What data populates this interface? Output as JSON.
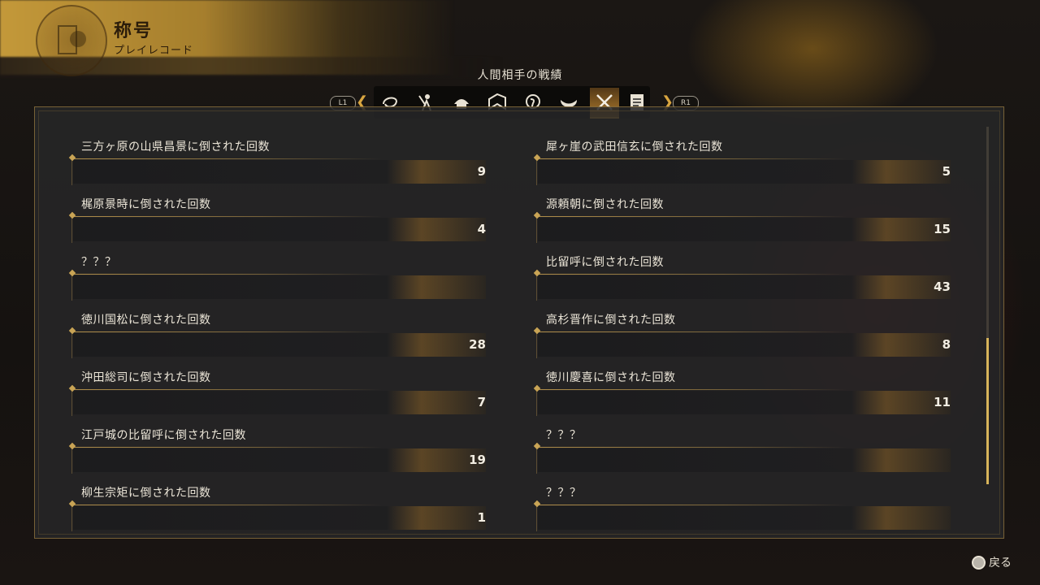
{
  "header": {
    "title": "称号",
    "subtitle": "プレイレコード"
  },
  "category": {
    "title": "人間相手の戦績",
    "left_shoulder": "L1",
    "right_shoulder": "R1",
    "tabs": [
      {
        "icon": "swirl-icon",
        "active": false
      },
      {
        "icon": "warrior-icon",
        "active": false
      },
      {
        "icon": "helmet-icon",
        "active": false
      },
      {
        "icon": "book-icon",
        "active": false
      },
      {
        "icon": "scroll-emblem-icon",
        "active": false
      },
      {
        "icon": "mask-icon",
        "active": false
      },
      {
        "icon": "crossed-swords-icon",
        "active": true
      },
      {
        "icon": "document-icon",
        "active": false
      }
    ]
  },
  "stats_left": [
    {
      "label": "三方ヶ原の山県昌景に倒された回数",
      "value": "9"
    },
    {
      "label": "梶原景時に倒された回数",
      "value": "4"
    },
    {
      "label": "？？？",
      "value": ""
    },
    {
      "label": "徳川国松に倒された回数",
      "value": "28"
    },
    {
      "label": "沖田総司に倒された回数",
      "value": "7"
    },
    {
      "label": "江戸城の比留呼に倒された回数",
      "value": "19"
    },
    {
      "label": "柳生宗矩に倒された回数",
      "value": "1"
    }
  ],
  "stats_right": [
    {
      "label": "犀ヶ崖の武田信玄に倒された回数",
      "value": "5"
    },
    {
      "label": "源頼朝に倒された回数",
      "value": "15"
    },
    {
      "label": "比留呼に倒された回数",
      "value": "43"
    },
    {
      "label": "高杉晋作に倒された回数",
      "value": "8"
    },
    {
      "label": "徳川慶喜に倒された回数",
      "value": "11"
    },
    {
      "label": "？？？",
      "value": ""
    },
    {
      "label": "？？？",
      "value": ""
    }
  ],
  "footer": {
    "back_label": "戻る"
  },
  "colors": {
    "accent": "#d9a640",
    "panel": "#262628"
  }
}
